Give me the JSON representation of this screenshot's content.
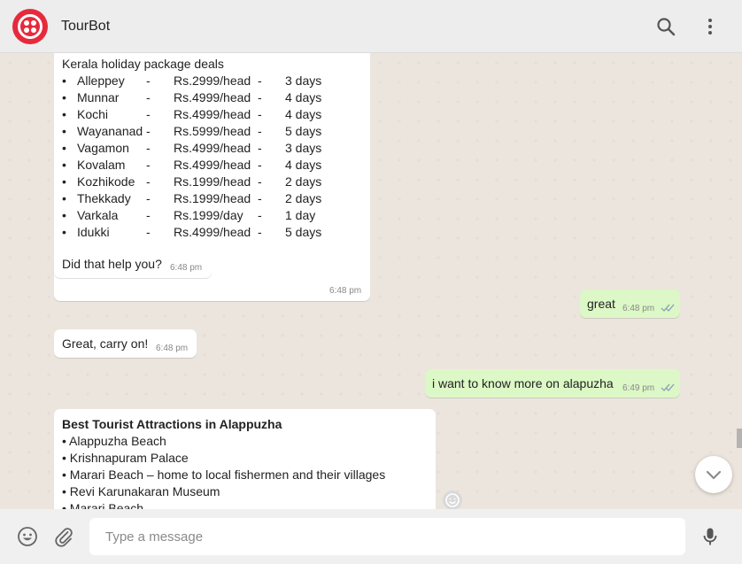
{
  "header": {
    "title": "TourBot",
    "logo_icon": "twilio-logo",
    "search_icon": "search-icon",
    "menu_icon": "kebab-menu-icon",
    "brand_color": "#e62a3c"
  },
  "messages": {
    "kerala": {
      "heading": "Kerala holiday package deals",
      "items": [
        {
          "bullet": "•",
          "place": "Alleppey",
          "dash1": "-",
          "price": "Rs.2999/head",
          "dash2": "-",
          "days": "3 days"
        },
        {
          "bullet": "•",
          "place": "Munnar",
          "dash1": "-",
          "price": "Rs.4999/head",
          "dash2": "-",
          "days": "4 days"
        },
        {
          "bullet": "•",
          "place": "Kochi",
          "dash1": "-",
          "price": "Rs.4999/head",
          "dash2": "-",
          "days": "4 days"
        },
        {
          "bullet": "•",
          "place": "Wayananad",
          "dash1": "-",
          "price": "Rs.5999/head",
          "dash2": "-",
          "days": "5 days"
        },
        {
          "bullet": "•",
          "place": "Vagamon",
          "dash1": "-",
          "price": "Rs.4999/head",
          "dash2": "-",
          "days": "3 days"
        },
        {
          "bullet": "•",
          "place": "Kovalam",
          "dash1": "-",
          "price": "Rs.4999/head",
          "dash2": "-",
          "days": "4 days"
        },
        {
          "bullet": "•",
          "place": "Kozhikode",
          "dash1": "-",
          "price": "Rs.1999/head",
          "dash2": "-",
          "days": "2 days"
        },
        {
          "bullet": "•",
          "place": "Thekkady",
          "dash1": "-",
          "price": "Rs.1999/head",
          "dash2": "-",
          "days": "2 days"
        },
        {
          "bullet": "•",
          "place": "Varkala",
          "dash1": "-",
          "price": "Rs.1999/day",
          "dash2": "-",
          "days": "1 day"
        },
        {
          "bullet": "•",
          "place": "Idukki",
          "dash1": "-",
          "price": "Rs.4999/head",
          "dash2": "-",
          "days": "5 days"
        }
      ],
      "time": "6:48 pm"
    },
    "help": {
      "text": "Did that help you?",
      "time": "6:48 pm"
    },
    "great": {
      "text": "great",
      "time": "6:48 pm",
      "status_icon": "double-check-icon"
    },
    "carry": {
      "text": "Great, carry on!",
      "time": "6:48 pm"
    },
    "alapuzha": {
      "text": "i want to know more on alapuzha",
      "time": "6:49 pm",
      "status_icon": "double-check-icon"
    },
    "attractions": {
      "heading": "Best Tourist Attractions in Alappuzha",
      "items": [
        "• Alappuzha Beach",
        "• Krishnapuram Palace",
        "• Marari Beach – home to local fishermen and their villages",
        "• Revi Karunakaran Museum",
        "• Marari Beach"
      ]
    }
  },
  "chat_ui": {
    "react_icon": "smiley-icon",
    "scroll_icon": "chevron-down-icon"
  },
  "footer": {
    "emoji_icon": "smiley-icon",
    "attach_icon": "paperclip-icon",
    "placeholder": "Type a message",
    "mic_icon": "microphone-icon"
  },
  "colors": {
    "outgoing_bubble": "#dcf8c6",
    "incoming_bubble": "#ffffff",
    "chat_background": "#ece5dd",
    "read_ticks": "#8fa7b8"
  }
}
